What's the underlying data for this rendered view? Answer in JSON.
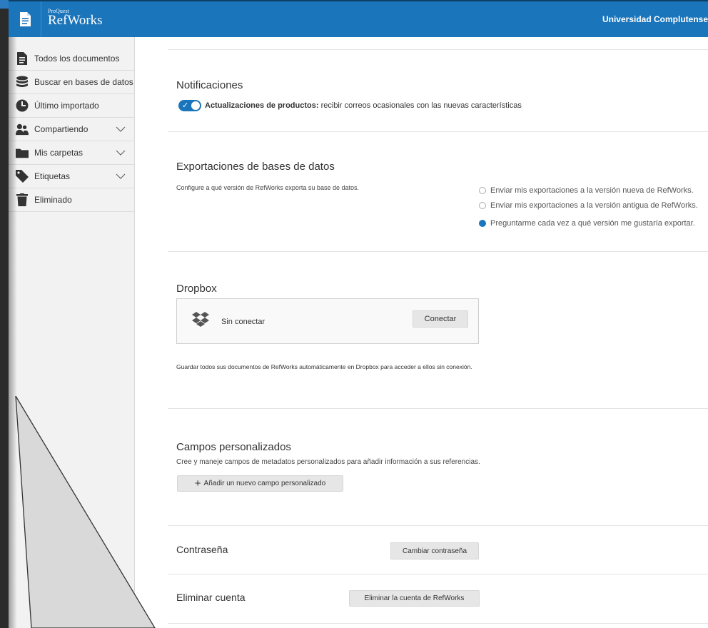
{
  "header": {
    "brand_small": "ProQuest",
    "brand_main": "RefWorks",
    "institution": "Universidad Complutense"
  },
  "sidebar": {
    "items": [
      {
        "label": "Todos los documentos",
        "icon": "document-icon"
      },
      {
        "label": "Buscar en bases de datos",
        "icon": "database-icon"
      },
      {
        "label": "Último importado",
        "icon": "clock-icon"
      },
      {
        "label": "Compartiendo",
        "icon": "people-icon",
        "expandable": true
      },
      {
        "label": "Mis carpetas",
        "icon": "folder-icon",
        "expandable": true
      },
      {
        "label": "Etiquetas",
        "icon": "tag-icon",
        "expandable": true
      },
      {
        "label": "Eliminado",
        "icon": "trash-icon"
      }
    ]
  },
  "notifications": {
    "title": "Notificaciones",
    "toggle_on": true,
    "product_updates_label": "Actualizaciones de productos:",
    "product_updates_desc": "recibir correos ocasionales con las nuevas características"
  },
  "db_exports": {
    "title": "Exportaciones de bases de datos",
    "description": "Configure a qué versión de RefWorks exporta su base de datos.",
    "options": [
      {
        "label": "Enviar mis exportaciones a la versión nueva de RefWorks.",
        "selected": false
      },
      {
        "label": "Enviar mis exportaciones a la versión antigua de RefWorks.",
        "selected": false
      },
      {
        "label": "Preguntarme cada vez a qué versión me gustaría exportar.",
        "selected": true
      }
    ]
  },
  "dropbox": {
    "title": "Dropbox",
    "status": "Sin conectar",
    "connect_label": "Conectar",
    "description": "Guardar todos sus documentos de RefWorks automáticamente en Dropbox para acceder a ellos sin conexión."
  },
  "custom_fields": {
    "title": "Campos personalizados",
    "description": "Cree y maneje campos de metadatos personalizados para añadir información a sus referencias.",
    "add_label": "Añadir un nuevo campo personalizado"
  },
  "password": {
    "title": "Contraseña",
    "button_label": "Cambiar contraseña"
  },
  "delete_account": {
    "title": "Eliminar cuenta",
    "button_label": "Eliminar la cuenta de RefWorks"
  },
  "colors": {
    "accent": "#1b75bb",
    "sidebar_bg": "#f2f2f2"
  }
}
